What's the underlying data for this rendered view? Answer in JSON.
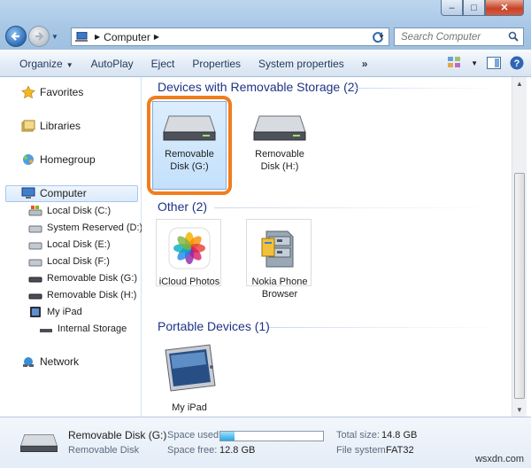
{
  "window": {
    "minimize": "–",
    "maximize": "□",
    "close": "✕"
  },
  "address": {
    "segment": "Computer"
  },
  "search": {
    "placeholder": "Search Computer"
  },
  "toolbar": {
    "organize": "Organize",
    "autoplay": "AutoPlay",
    "eject": "Eject",
    "properties": "Properties",
    "system_properties": "System properties",
    "more": "»"
  },
  "navpane": {
    "favorites": "Favorites",
    "libraries": "Libraries",
    "homegroup": "Homegroup",
    "computer": "Computer",
    "drives": [
      "Local Disk (C:)",
      "System Reserved (D:)",
      "Local Disk (E:)",
      "Local Disk (F:)",
      "Removable Disk (G:)",
      "Removable Disk (H:)",
      "My iPad"
    ],
    "internal_storage": "Internal Storage",
    "network": "Network"
  },
  "content": {
    "group_removable": "Devices with Removable Storage (2)",
    "disk_g_line1": "Removable",
    "disk_g_line2": "Disk (G:)",
    "disk_h_line1": "Removable",
    "disk_h_line2": "Disk (H:)",
    "group_other": "Other (2)",
    "icloud": "iCloud Photos",
    "nokia_line1": "Nokia Phone",
    "nokia_line2": "Browser",
    "group_portable": "Portable Devices (1)",
    "ipad": "My iPad"
  },
  "details": {
    "name": "Removable Disk (G:)",
    "type": "Removable Disk",
    "space_used_label": "Space used:",
    "space_free_label": "Space free:",
    "space_free": "12.8 GB",
    "total_size_label": "Total size:",
    "total_size": "14.8 GB",
    "fs_label": "File system:",
    "fs": "FAT32",
    "used_fraction": 0.14
  },
  "watermark": "wsxdn.com",
  "colors": {
    "highlight": "#f07d1e",
    "group_header": "#1e3287"
  }
}
